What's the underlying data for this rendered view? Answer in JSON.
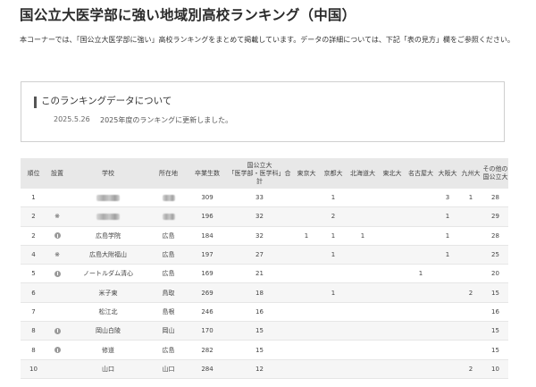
{
  "page": {
    "title": "国公立大医学部に強い地域別高校ランキング（中国）",
    "intro": "本コーナーでは、「国公立大医学部に強い」高校ランキングをまとめて掲載しています。データの詳細については、下記「表の見方」欄をご参照ください。"
  },
  "info": {
    "heading": "このランキングデータについて",
    "date": "2025.5.26",
    "note": "2025年度のランキングに更新しました。"
  },
  "table": {
    "headers": {
      "rank": "順位",
      "type": "設置",
      "school": "学校",
      "location": "所在地",
      "graduates": "卒業生数",
      "total_l1": "国公立大",
      "total_l2": "「医学部・医学科」合計",
      "tokyo": "東京大",
      "kyoto": "京都大",
      "hokkaido": "北海道大",
      "tohoku": "東北大",
      "nagoya": "名古屋大",
      "osaka": "大阪大",
      "kyushu": "九州大",
      "other_l1": "その他の",
      "other_l2": "国公立大"
    },
    "rows": [
      {
        "rank": "1",
        "mark": "",
        "school": "",
        "location": "",
        "graduates": "309",
        "total": "33",
        "tokyo": "",
        "kyoto": "1",
        "hokkaido": "",
        "tohoku": "",
        "nagoya": "",
        "osaka": "3",
        "kyushu": "1",
        "other": "28"
      },
      {
        "rank": "2",
        "mark": "※",
        "school": "",
        "location": "",
        "graduates": "196",
        "total": "32",
        "tokyo": "",
        "kyoto": "2",
        "hokkaido": "",
        "tohoku": "",
        "nagoya": "",
        "osaka": "1",
        "kyushu": "",
        "other": "29"
      },
      {
        "rank": "2",
        "mark": "私",
        "school": "広島学院",
        "location": "広島",
        "graduates": "184",
        "total": "32",
        "tokyo": "1",
        "kyoto": "1",
        "hokkaido": "1",
        "tohoku": "",
        "nagoya": "",
        "osaka": "1",
        "kyushu": "",
        "other": "28"
      },
      {
        "rank": "4",
        "mark": "※",
        "school": "広島大附福山",
        "location": "広島",
        "graduates": "197",
        "total": "27",
        "tokyo": "",
        "kyoto": "1",
        "hokkaido": "",
        "tohoku": "",
        "nagoya": "",
        "osaka": "1",
        "kyushu": "",
        "other": "25"
      },
      {
        "rank": "5",
        "mark": "私",
        "school": "ノートルダム清心",
        "location": "広島",
        "graduates": "169",
        "total": "21",
        "tokyo": "",
        "kyoto": "",
        "hokkaido": "",
        "tohoku": "",
        "nagoya": "1",
        "osaka": "",
        "kyushu": "",
        "other": "20"
      },
      {
        "rank": "6",
        "mark": "",
        "school": "米子東",
        "location": "鳥取",
        "graduates": "269",
        "total": "18",
        "tokyo": "",
        "kyoto": "1",
        "hokkaido": "",
        "tohoku": "",
        "nagoya": "",
        "osaka": "",
        "kyushu": "2",
        "other": "15"
      },
      {
        "rank": "7",
        "mark": "",
        "school": "松江北",
        "location": "島根",
        "graduates": "246",
        "total": "16",
        "tokyo": "",
        "kyoto": "",
        "hokkaido": "",
        "tohoku": "",
        "nagoya": "",
        "osaka": "",
        "kyushu": "",
        "other": "16"
      },
      {
        "rank": "8",
        "mark": "私",
        "school": "岡山白陵",
        "location": "岡山",
        "graduates": "170",
        "total": "15",
        "tokyo": "",
        "kyoto": "",
        "hokkaido": "",
        "tohoku": "",
        "nagoya": "",
        "osaka": "",
        "kyushu": "",
        "other": "15"
      },
      {
        "rank": "8",
        "mark": "私",
        "school": "修道",
        "location": "広島",
        "graduates": "282",
        "total": "15",
        "tokyo": "",
        "kyoto": "",
        "hokkaido": "",
        "tohoku": "",
        "nagoya": "",
        "osaka": "",
        "kyushu": "",
        "other": "15"
      },
      {
        "rank": "10",
        "mark": "",
        "school": "山口",
        "location": "山口",
        "graduates": "284",
        "total": "12",
        "tokyo": "",
        "kyoto": "",
        "hokkaido": "",
        "tohoku": "",
        "nagoya": "",
        "osaka": "",
        "kyushu": "2",
        "other": "10"
      }
    ]
  }
}
